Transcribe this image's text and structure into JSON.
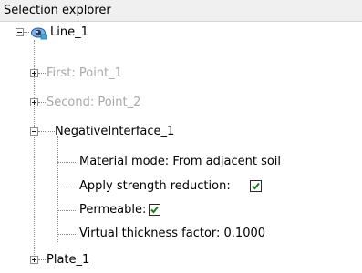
{
  "panel": {
    "title": "Selection explorer"
  },
  "tree": {
    "root": {
      "label": "Line_1",
      "icon": "visibility-eye-icon",
      "expanded": true
    },
    "first": {
      "label": "First: Point_1",
      "expanded": false,
      "enabled": false
    },
    "second": {
      "label": "Second: Point_2",
      "expanded": false,
      "enabled": false
    },
    "interface": {
      "label": "NegativeInterface_1",
      "expanded": true,
      "material_mode": "Material mode: From adjacent soil",
      "strength_reduction": {
        "label": "Apply strength reduction:",
        "checked": true
      },
      "permeable": {
        "label": "Permeable:",
        "checked": true
      },
      "thickness": "Virtual thickness factor: 0.1000"
    },
    "plate": {
      "label": "Plate_1",
      "expanded": false
    }
  },
  "colors": {
    "check": "#1a7d1a",
    "disabled_text": "#a8a8a8",
    "header_bg": "#f0f0f0"
  }
}
